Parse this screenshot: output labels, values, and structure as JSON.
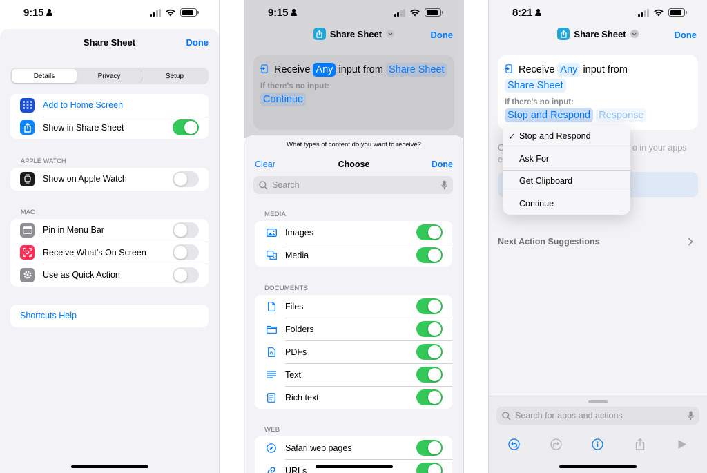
{
  "colors": {
    "accent": "#007aff",
    "toggle_on": "#34c759",
    "share_icon": "#22a6d8"
  },
  "panel1": {
    "status": {
      "time": "9:15"
    },
    "title": "Share Sheet",
    "done": "Done",
    "segments": [
      {
        "label": "Details",
        "selected": true
      },
      {
        "label": "Privacy",
        "selected": false
      },
      {
        "label": "Setup",
        "selected": false
      }
    ],
    "rows_main": [
      {
        "label": "Add to Home Screen",
        "icon": "home-screen-icon",
        "link": true
      },
      {
        "label": "Show in Share Sheet",
        "icon": "share-icon",
        "toggle": true
      }
    ],
    "apple_watch": {
      "caption": "APPLE WATCH",
      "rows": [
        {
          "label": "Show on Apple Watch",
          "icon": "apple-watch-icon",
          "toggle": false
        }
      ]
    },
    "mac": {
      "caption": "MAC",
      "rows": [
        {
          "label": "Pin in Menu Bar",
          "icon": "menu-bar-icon",
          "toggle": false
        },
        {
          "label": "Receive What’s On Screen",
          "icon": "screen-capture-icon",
          "toggle": false
        },
        {
          "label": "Use as Quick Action",
          "icon": "gear-icon",
          "toggle": false
        }
      ]
    },
    "help": "Shortcuts Help"
  },
  "panel2": {
    "status": {
      "time": "9:15"
    },
    "nav_title": "Share Sheet",
    "done": "Done",
    "action": {
      "receive": "Receive",
      "any": "Any",
      "input_from": "input from",
      "source": "Share Sheet",
      "no_input": "If there’s no input:",
      "fallback": "Continue"
    },
    "sheet": {
      "question": "What types of content do you want to receive?",
      "clear": "Clear",
      "title": "Choose",
      "done": "Done",
      "search_placeholder": "Search",
      "media_caption": "MEDIA",
      "media": [
        {
          "label": "Images",
          "icon": "image-icon",
          "toggle": true
        },
        {
          "label": "Media",
          "icon": "media-icon",
          "toggle": true
        }
      ],
      "documents_caption": "DOCUMENTS",
      "documents": [
        {
          "label": "Files",
          "icon": "file-icon",
          "toggle": true
        },
        {
          "label": "Folders",
          "icon": "folder-icon",
          "toggle": true
        },
        {
          "label": "PDFs",
          "icon": "pdf-icon",
          "toggle": true
        },
        {
          "label": "Text",
          "icon": "text-icon",
          "toggle": true
        },
        {
          "label": "Rich text",
          "icon": "rich-text-icon",
          "toggle": true
        }
      ],
      "web_caption": "WEB",
      "web": [
        {
          "label": "Safari web pages",
          "icon": "compass-icon",
          "toggle": true
        },
        {
          "label": "URLs",
          "icon": "link-icon",
          "toggle": true
        }
      ]
    }
  },
  "panel3": {
    "status": {
      "time": "8:21"
    },
    "nav_title": "Share Sheet",
    "done": "Done",
    "action": {
      "receive": "Receive",
      "any": "Any",
      "input_from": "input from",
      "source": "Share Sheet",
      "no_input": "If there’s no input:",
      "fallback": "Stop and Respond",
      "response": "Response"
    },
    "behind_text_right": "o in your apps",
    "behind_text_left_1": "C",
    "behind_text_left_2": "e",
    "menu": [
      {
        "label": "Stop and Respond",
        "checked": true
      },
      {
        "label": "Ask For",
        "checked": false
      },
      {
        "label": "Get Clipboard",
        "checked": false
      },
      {
        "label": "Continue",
        "checked": false
      }
    ],
    "check_glyph": "✓",
    "next_suggestions": "Next Action Suggestions",
    "search_placeholder": "Search for apps and actions"
  }
}
